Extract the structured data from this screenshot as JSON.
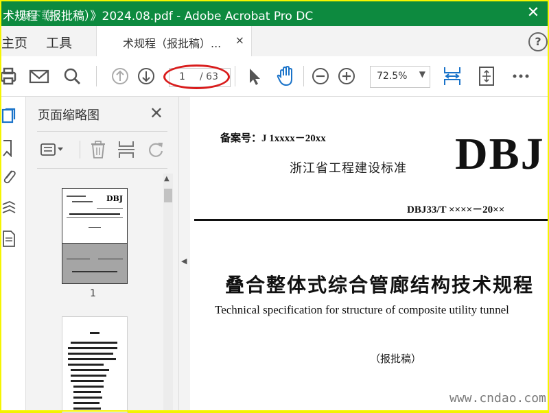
{
  "window": {
    "title": "术规程（报批稿）》2024.08.pdf - Adobe Acrobat Pro DC",
    "title_watermark": "安下载",
    "close_glyph": "✕",
    "titlebar_color": "#0d8a3f"
  },
  "tabs": {
    "home": "主页",
    "tools": "工具",
    "document": "术规程（报批稿）...",
    "document_close": "×",
    "help": "?"
  },
  "toolbar": {
    "icons": [
      "print-icon",
      "email-icon",
      "search-icon",
      "page-up-icon",
      "page-down-icon",
      "select-arrow-icon",
      "hand-icon",
      "zoom-out-icon",
      "zoom-in-icon",
      "fit-width-icon",
      "fit-page-icon",
      "more-icon"
    ],
    "current_page": "1",
    "total_pages": "/ 63",
    "zoom": "72.5%",
    "zoom_arrow": "▼"
  },
  "left_rail": {
    "icons": [
      "page-thumbnails-icon",
      "bookmark-icon",
      "attachment-icon",
      "layers-icon",
      "document-icon"
    ]
  },
  "thumbnail_pane": {
    "title": "页面缩略图",
    "close": "✕",
    "icons": [
      "options-menu-icon",
      "delete-icon",
      "insert-page-icon",
      "rotate-icon"
    ],
    "pages": [
      {
        "number": "1",
        "thumb_logo": "DBJ"
      },
      {
        "number": ""
      }
    ]
  },
  "document_page": {
    "registration": "备案号：J 1xxxx－20xx",
    "standard_type": "浙江省工程建设标准",
    "logo": "DBJ",
    "code": "DBJ33/T  ××××－20××",
    "title_cn": "叠合整体式综合管廊结构技术规程",
    "title_en": "Technical specification for structure of composite utility tunnel",
    "draft": "（报批稿）"
  },
  "watermark": "www.cndao.com",
  "colors": {
    "accent_blue": "#1a73c9",
    "highlight_red": "#d91c1c",
    "border_yellow": "#f5f500"
  }
}
